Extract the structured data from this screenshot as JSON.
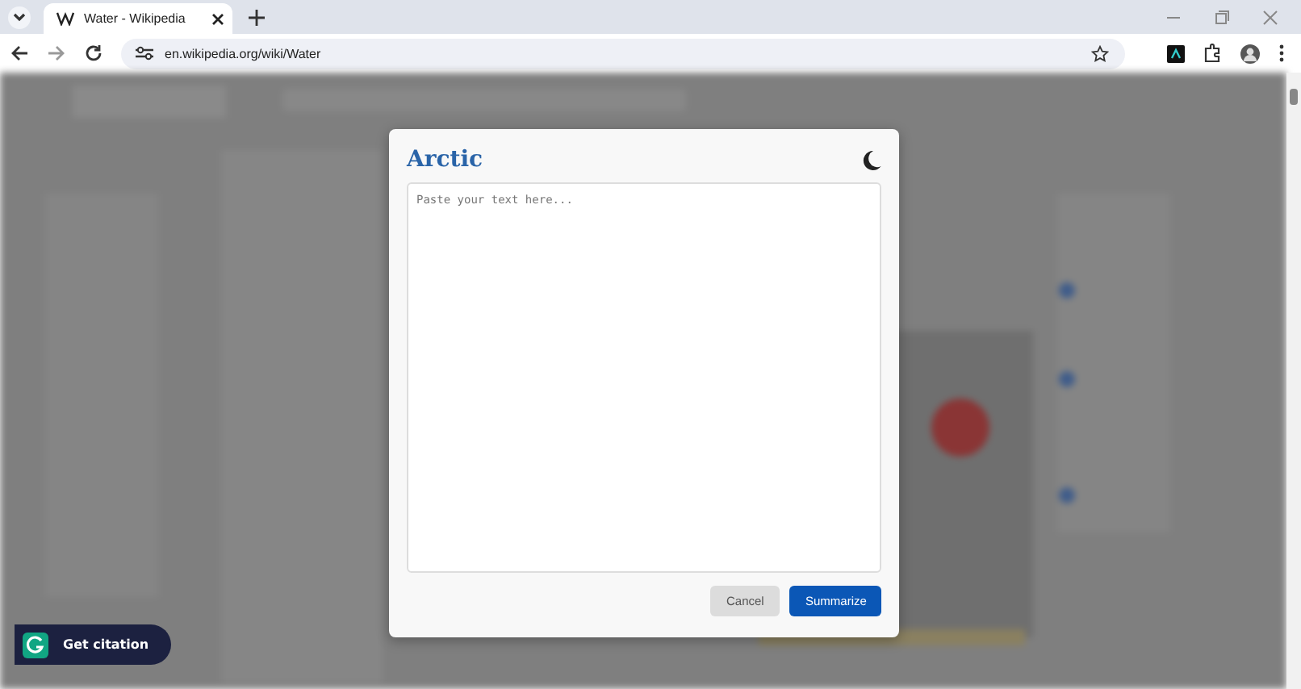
{
  "browser": {
    "tabs": [
      {
        "title": "Water - Wikipedia",
        "selected": true
      }
    ],
    "address": "en.wikipedia.org/wiki/Water"
  },
  "dialog": {
    "title": "Arctic",
    "text_area": {
      "placeholder": "Paste your text here..."
    },
    "buttons": [
      {
        "label": "Cancel",
        "kind": "secondary"
      },
      {
        "label": "Summarize",
        "kind": "primary"
      }
    ]
  },
  "citation_button": {
    "label": "Get citation"
  }
}
